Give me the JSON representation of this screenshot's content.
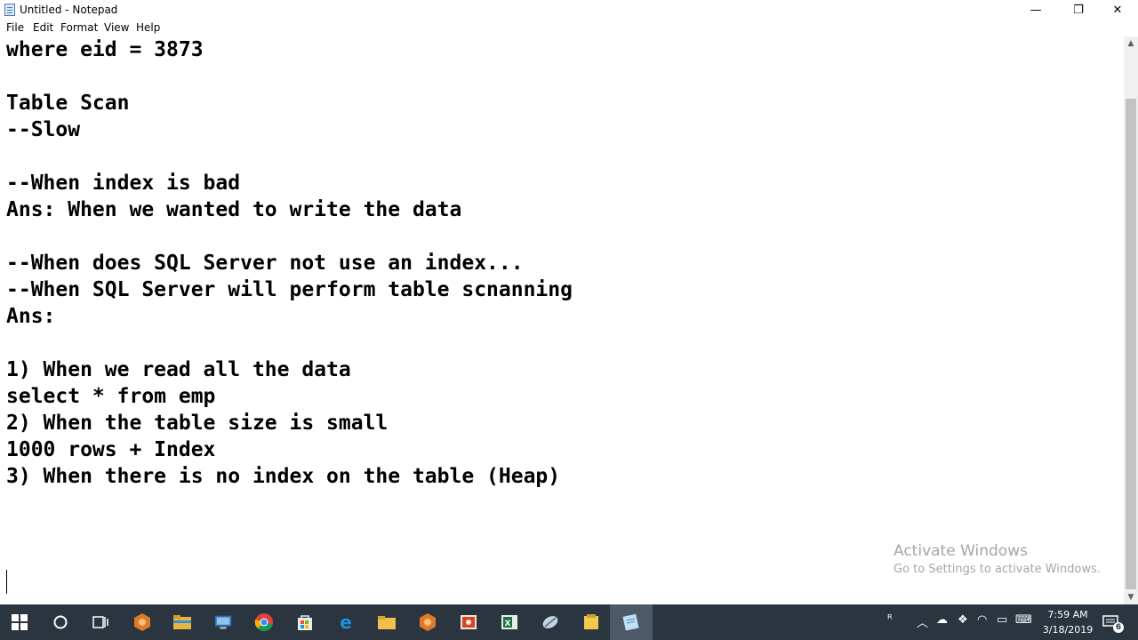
{
  "window": {
    "title": "Untitled - Notepad",
    "controls": {
      "minimize": "—",
      "restore": "❐",
      "close": "✕"
    }
  },
  "menu": [
    "File",
    "Edit",
    "Format",
    "View",
    "Help"
  ],
  "editor": {
    "lines": [
      "where eid = 3873",
      "",
      "Table Scan",
      "--Slow",
      "",
      "--When index is bad",
      "Ans: When we wanted to write the data",
      "",
      "--When does SQL Server not use an index...",
      "--When SQL Server will perform table scnanning",
      "Ans:",
      "",
      "1) When we read all the data",
      "select * from emp",
      "2) When the table size is small",
      "1000 rows + Index",
      "3) When there is no index on the table (Heap)"
    ]
  },
  "watermark": {
    "title": "Activate Windows",
    "subtitle": "Go to Settings to activate Windows."
  },
  "taskbar": {
    "icons": [
      "windows-start-icon",
      "cortana-search-icon",
      "task-view-icon",
      "app-icon",
      "file-explorer-icon",
      "remote-desktop-icon",
      "chrome-icon",
      "store-icon",
      "edge-icon",
      "folder-icon",
      "app-icon",
      "powerpoint-icon",
      "excel-icon",
      "sql-server-icon",
      "sticky-app-icon",
      "notepad-icon"
    ],
    "clock": {
      "time": "7:59 AM",
      "date": "3/18/2019"
    },
    "notification_count": "6"
  }
}
